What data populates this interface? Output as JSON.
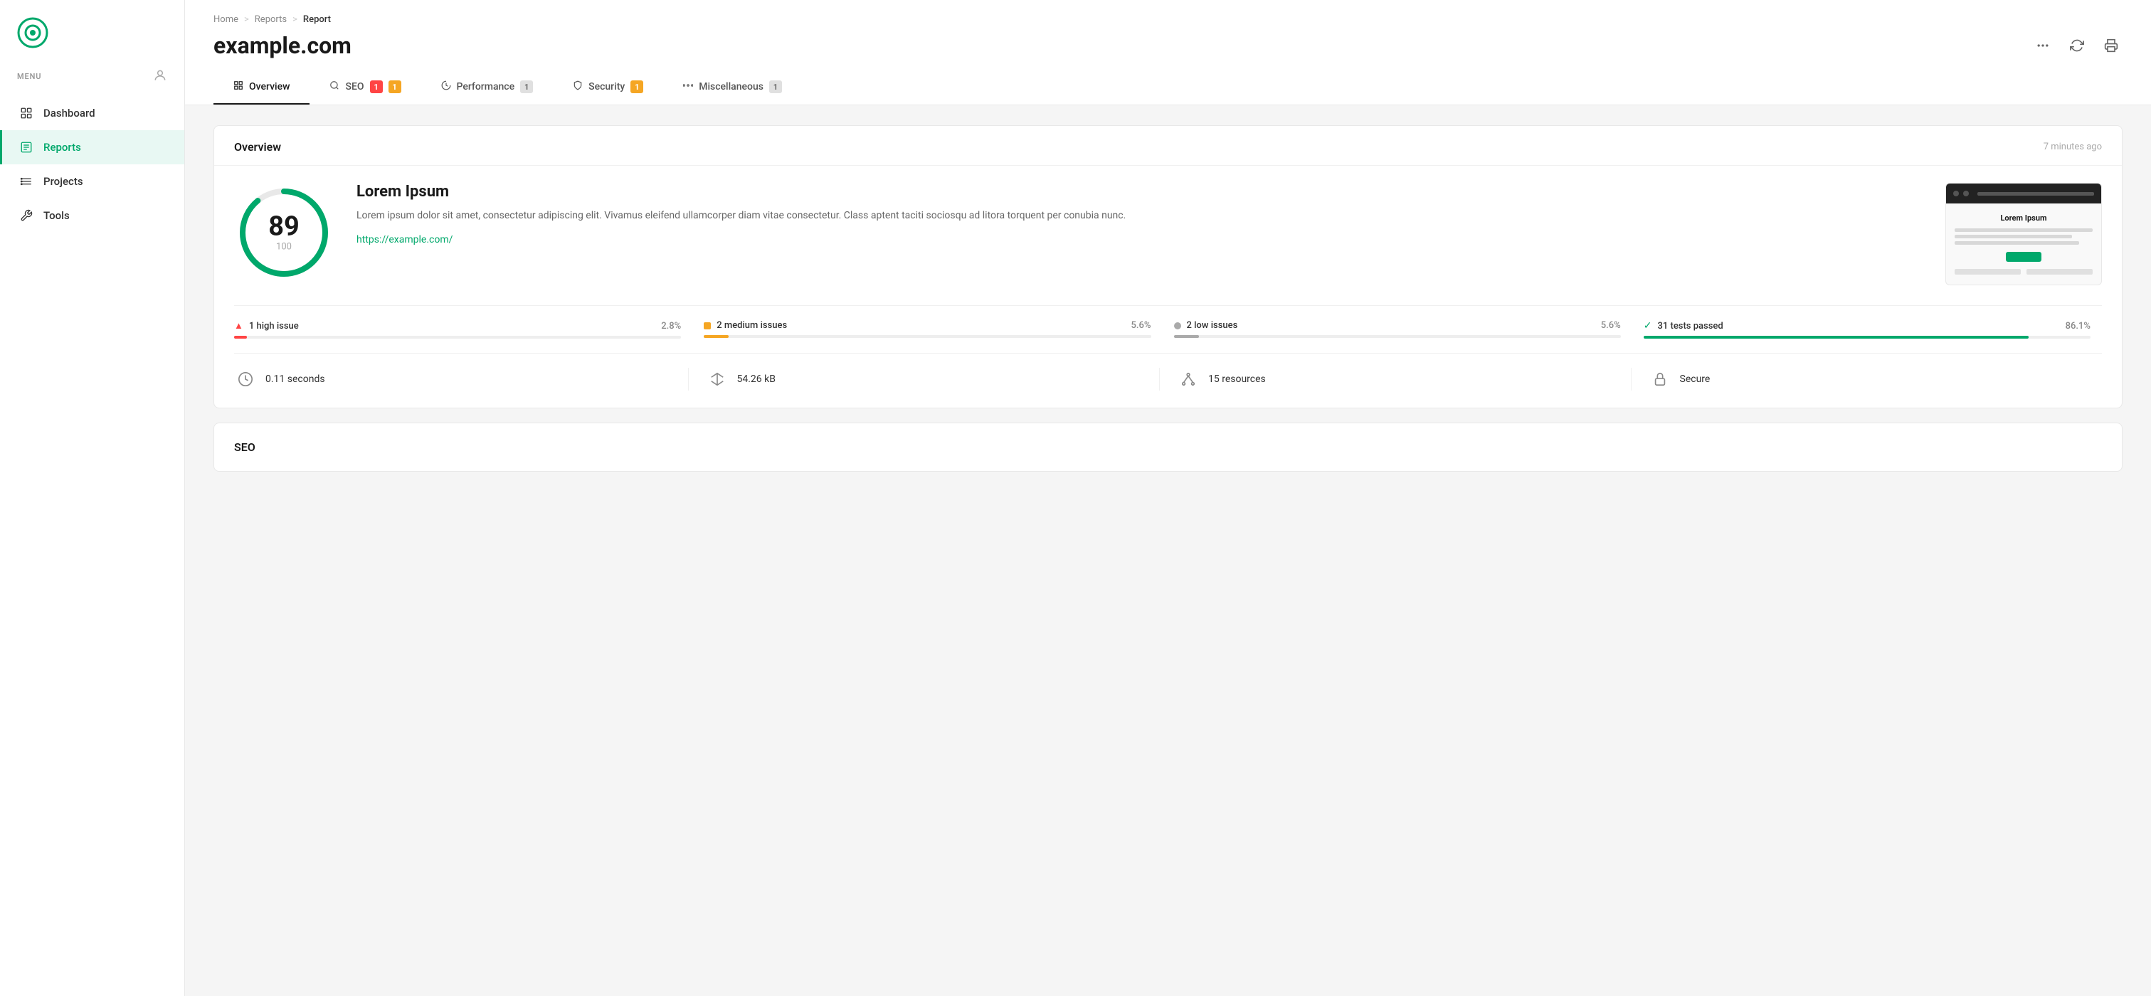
{
  "sidebar": {
    "menu_label": "MENU",
    "items": [
      {
        "id": "dashboard",
        "label": "Dashboard",
        "active": false
      },
      {
        "id": "reports",
        "label": "Reports",
        "active": true
      },
      {
        "id": "projects",
        "label": "Projects",
        "active": false
      },
      {
        "id": "tools",
        "label": "Tools",
        "active": false
      }
    ]
  },
  "breadcrumb": {
    "home": "Home",
    "sep1": ">",
    "reports": "Reports",
    "sep2": ">",
    "current": "Report"
  },
  "page": {
    "title": "example.com"
  },
  "tabs": [
    {
      "id": "overview",
      "label": "Overview",
      "badge": null,
      "active": true
    },
    {
      "id": "seo",
      "label": "SEO",
      "badge": [
        {
          "text": "1",
          "color": "red"
        },
        {
          "text": "1",
          "color": "yellow"
        }
      ],
      "active": false
    },
    {
      "id": "performance",
      "label": "Performance",
      "badge": [
        {
          "text": "1",
          "color": "gray"
        }
      ],
      "active": false
    },
    {
      "id": "security",
      "label": "Security",
      "badge": [
        {
          "text": "1",
          "color": "yellow"
        }
      ],
      "active": false
    },
    {
      "id": "miscellaneous",
      "label": "Miscellaneous",
      "badge": [
        {
          "text": "1",
          "color": "gray"
        }
      ],
      "active": false
    }
  ],
  "overview": {
    "section_title": "Overview",
    "time_ago": "7 minutes ago",
    "score": {
      "value": 89,
      "max": 100
    },
    "site": {
      "name": "Lorem Ipsum",
      "description": "Lorem ipsum dolor sit amet, consectetur adipiscing elit. Vivamus eleifend ullamcorper diam vitae consectetur. Class aptent taciti sociosqu ad litora torquent per conubia nunc.",
      "url": "https://example.com/"
    },
    "preview": {
      "title": "Lorem Ipsum",
      "button_label": ""
    },
    "issues": [
      {
        "id": "high",
        "icon": "triangle-warn",
        "label": "1 high issue",
        "pct": "2.8%",
        "fill_pct": 2.8,
        "color": "#ff4444",
        "dot_class": "red"
      },
      {
        "id": "medium",
        "icon": "square-yellow",
        "label": "2 medium issues",
        "pct": "5.6%",
        "fill_pct": 5.6,
        "color": "#f5a623",
        "dot_class": "yellow"
      },
      {
        "id": "low",
        "icon": "circle-gray",
        "label": "2 low issues",
        "pct": "5.6%",
        "fill_pct": 5.6,
        "color": "#aaa",
        "dot_class": "gray"
      },
      {
        "id": "passed",
        "icon": "check-green",
        "label": "31 tests passed",
        "pct": "86.1%",
        "fill_pct": 86.1,
        "color": "#00a86b",
        "dot_class": "green"
      }
    ],
    "stats": [
      {
        "id": "time",
        "icon": "clock",
        "value": "0.11 seconds"
      },
      {
        "id": "size",
        "icon": "scale",
        "value": "54.26 kB"
      },
      {
        "id": "resources",
        "icon": "network",
        "value": "15 resources"
      },
      {
        "id": "security",
        "icon": "lock",
        "value": "Secure"
      }
    ]
  },
  "seo": {
    "section_title": "SEO"
  },
  "colors": {
    "accent": "#00a86b",
    "accent_light": "#e8f8f3"
  }
}
